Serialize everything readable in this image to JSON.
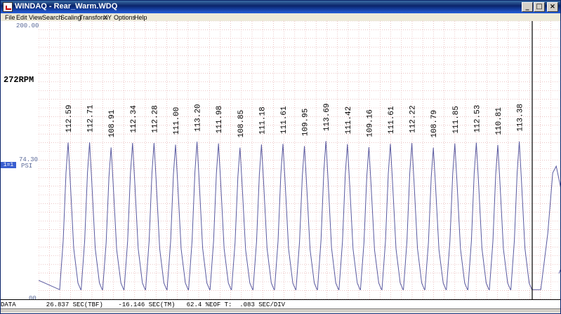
{
  "window": {
    "title": "WINDAQ - Rear_Warm.WDQ"
  },
  "title_buttons": {
    "minimize": "_",
    "maximize": "□",
    "close": "×"
  },
  "menu": [
    "File",
    "Edit",
    "View",
    "Search",
    "Scaling",
    "Transform",
    "XY",
    "Options",
    "Help"
  ],
  "channel": {
    "y_top": "200.00",
    "y_bottom": "00",
    "y_mid_value": "74.30",
    "unit": "PSI",
    "tag": "1=1",
    "rpm_readout": "272RPM"
  },
  "status": {
    "text": "DATA        26.837 SEC(TBF)    -16.146 SEC(TM)   62.4 %EOF T:  .083 SEC/DIV"
  },
  "colors": {
    "trace": "#5a5aa0",
    "grid": "#e0a0a0",
    "cursor": "#000000",
    "label": "#5b6a99"
  },
  "chart_data": {
    "type": "line",
    "ylim": [
      0,
      200
    ],
    "series": [
      {
        "values": [
          112.59,
          112.71,
          108.91,
          112.34,
          112.28,
          111.0,
          113.2,
          111.98,
          108.85,
          111.18,
          111.61,
          109.95,
          113.69,
          111.42,
          109.16,
          111.61,
          112.22,
          108.79,
          111.85,
          112.53,
          110.81,
          113.38
        ]
      }
    ],
    "peak_labels": [
      "112.59",
      "112.71",
      "108.91",
      "112.34",
      "112.28",
      "111.00",
      "113.20",
      "111.98",
      "108.85",
      "111.18",
      "111.61",
      "109.95",
      "113.69",
      "111.42",
      "109.16",
      "111.61",
      "112.22",
      "108.79",
      "111.85",
      "112.53",
      "110.81",
      "113.38"
    ],
    "grid": true
  }
}
